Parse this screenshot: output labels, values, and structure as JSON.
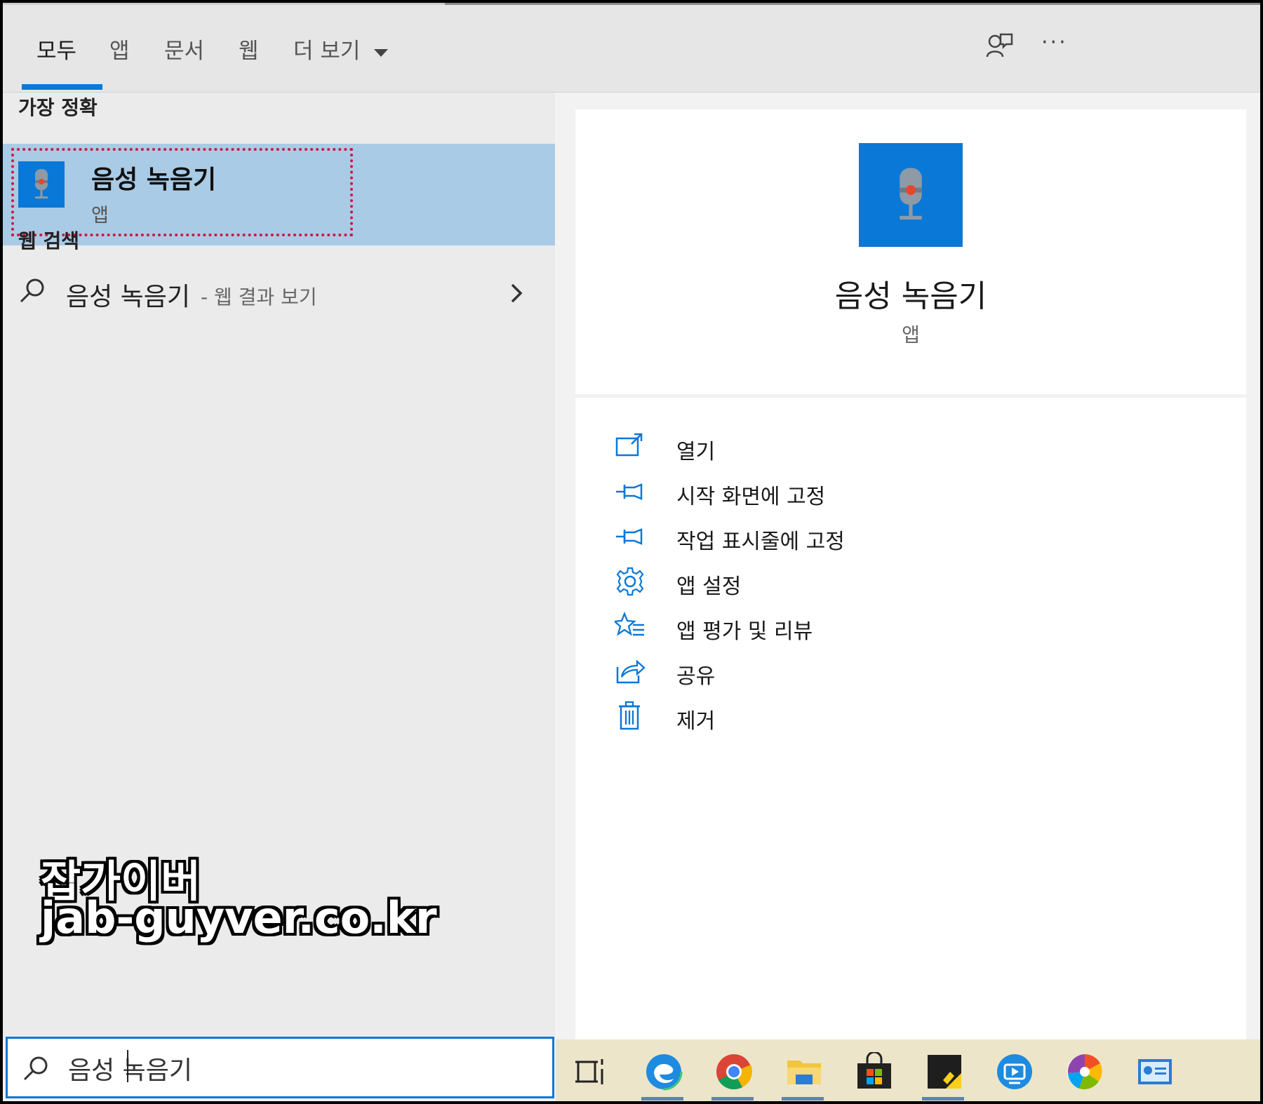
{
  "tabs": [
    {
      "label": "모두",
      "active": true
    },
    {
      "label": "앱"
    },
    {
      "label": "문서"
    },
    {
      "label": "웹"
    },
    {
      "label": "더 보기"
    }
  ],
  "toolbar": {
    "feedback_icon": "feedback-icon",
    "more_icon": "more-icon",
    "more_label": "···"
  },
  "best_match": {
    "section_title": "가장 정확",
    "app_name": "음성 녹음기",
    "app_type": "앱",
    "highlight_color": "#d0153f"
  },
  "web_search": {
    "section_title": "웹 검색",
    "query": "음성 녹음기",
    "suffix": "- 웹 결과 보기"
  },
  "detail": {
    "app_name": "음성 녹음기",
    "app_type": "앱",
    "actions": [
      {
        "label": "열기",
        "icon": "open-icon"
      },
      {
        "label": "시작 화면에 고정",
        "icon": "pin-icon"
      },
      {
        "label": "작업 표시줄에 고정",
        "icon": "pin-icon"
      },
      {
        "label": "앱 설정",
        "icon": "gear-icon"
      },
      {
        "label": "앱 평가 및 리뷰",
        "icon": "star-list-icon"
      },
      {
        "label": "공유",
        "icon": "share-icon"
      },
      {
        "label": "제거",
        "icon": "trash-icon"
      }
    ]
  },
  "search_box": {
    "value": "음성 녹음기"
  },
  "taskbar": {
    "items": [
      "task-view-icon",
      "edge-icon",
      "chrome-icon",
      "file-explorer-icon",
      "store-icon",
      "sticky-notes-icon",
      "remote-app-icon",
      "photos-app-icon",
      "control-panel-icon"
    ]
  },
  "watermark": {
    "line1": "잡가이버",
    "line2": "jab-guyver.co.kr"
  },
  "colors": {
    "accent": "#0a78d7",
    "selected_row": "#a9cbe6",
    "taskbar": "#ece5c9"
  }
}
